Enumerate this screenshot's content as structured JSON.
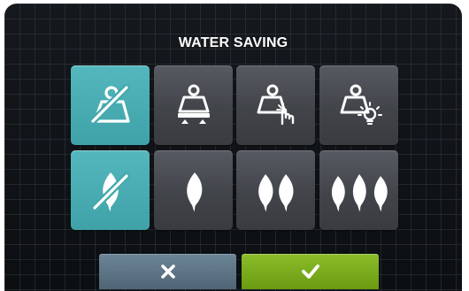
{
  "screen": {
    "title": "WATER SAVING"
  },
  "colors": {
    "selected_tile": "#45a9ae",
    "unselected_tile": "#46494f",
    "cancel_button": "#5d7486",
    "confirm_button": "#7aab1d"
  },
  "load_options": [
    {
      "icon": "load-sensor-off-icon",
      "selected": true
    },
    {
      "icon": "load-weighing-icon",
      "selected": false
    },
    {
      "icon": "load-manual-select-icon",
      "selected": false
    },
    {
      "icon": "load-auto-detect-icon",
      "selected": false
    }
  ],
  "saving_levels": [
    {
      "icon": "eco-off-icon",
      "selected": true
    },
    {
      "icon": "one-leaf-icon",
      "selected": false
    },
    {
      "icon": "two-leaves-icon",
      "selected": false
    },
    {
      "icon": "three-leaves-icon",
      "selected": false
    }
  ],
  "actions": {
    "cancel_icon": "close-icon",
    "confirm_icon": "checkmark-icon"
  }
}
